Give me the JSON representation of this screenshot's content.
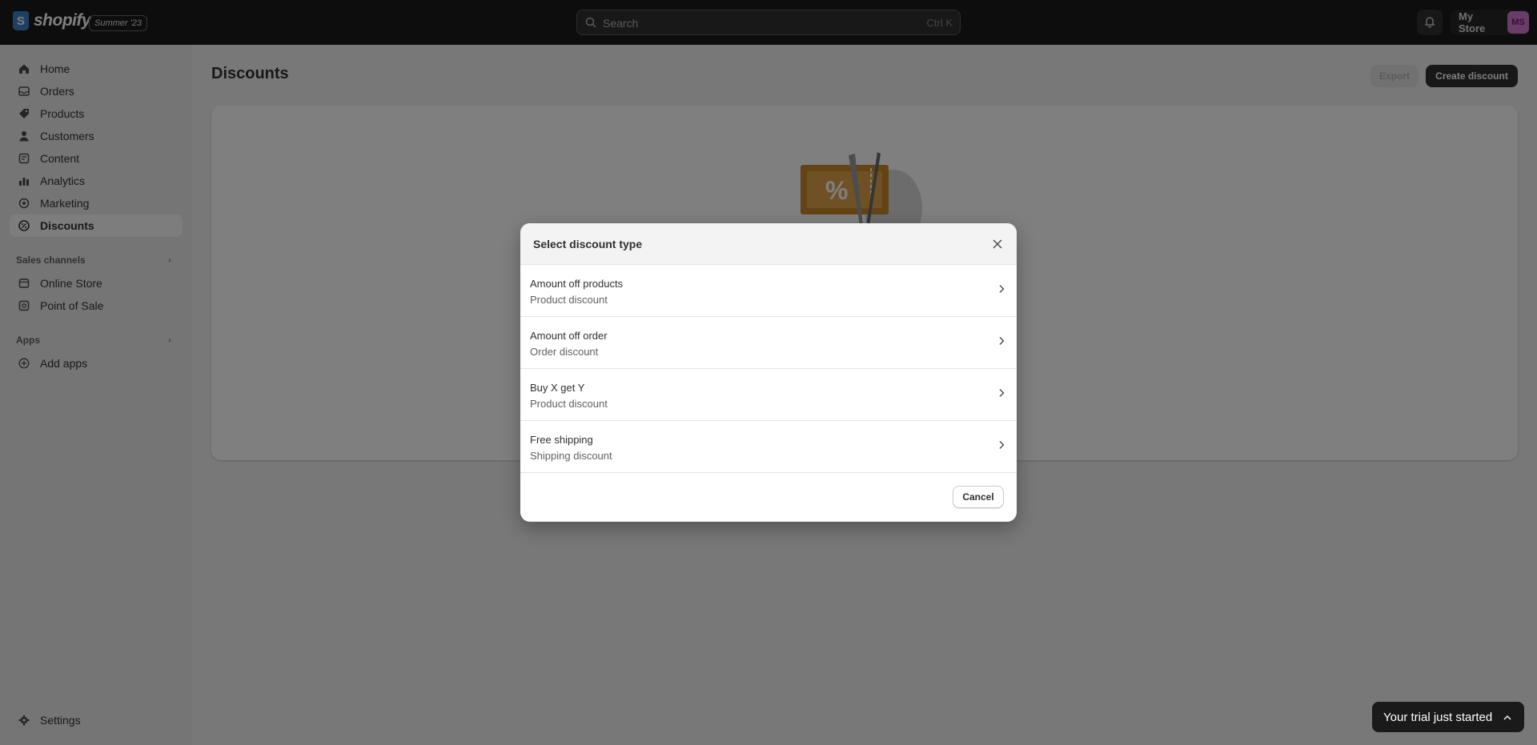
{
  "topbar": {
    "logo_text": "shopify",
    "logo_letter": "S",
    "edition_badge": "Summer '23",
    "search_placeholder": "Search",
    "search_shortcut": "Ctrl K",
    "store_name": "My Store",
    "avatar_initials": "MS"
  },
  "sidebar": {
    "items": [
      {
        "label": "Home",
        "icon": "home-icon"
      },
      {
        "label": "Orders",
        "icon": "orders-icon"
      },
      {
        "label": "Products",
        "icon": "tag-icon"
      },
      {
        "label": "Customers",
        "icon": "person-icon"
      },
      {
        "label": "Content",
        "icon": "content-icon"
      },
      {
        "label": "Analytics",
        "icon": "bar-chart-icon"
      },
      {
        "label": "Marketing",
        "icon": "target-icon"
      },
      {
        "label": "Discounts",
        "icon": "discount-icon",
        "active": true
      }
    ],
    "sales_channels_title": "Sales channels",
    "sales_channels": [
      {
        "label": "Online Store",
        "icon": "store-icon"
      },
      {
        "label": "Point of Sale",
        "icon": "pos-icon"
      }
    ],
    "apps_title": "Apps",
    "add_apps_label": "Add apps",
    "settings_label": "Settings"
  },
  "main": {
    "title": "Discounts",
    "export_label": "Export",
    "create_label": "Create discount"
  },
  "modal": {
    "title": "Select discount type",
    "options": [
      {
        "title": "Amount off products",
        "subtitle": "Product discount"
      },
      {
        "title": "Amount off order",
        "subtitle": "Order discount"
      },
      {
        "title": "Buy X get Y",
        "subtitle": "Product discount"
      },
      {
        "title": "Free shipping",
        "subtitle": "Shipping discount"
      }
    ],
    "cancel_label": "Cancel"
  },
  "trial": {
    "label": "Your trial just started"
  },
  "colors": {
    "topbar": "#1a1a1a",
    "sidebar": "#ebebeb",
    "primary_button": "#303030",
    "illustration_orange": "#c8862a"
  }
}
